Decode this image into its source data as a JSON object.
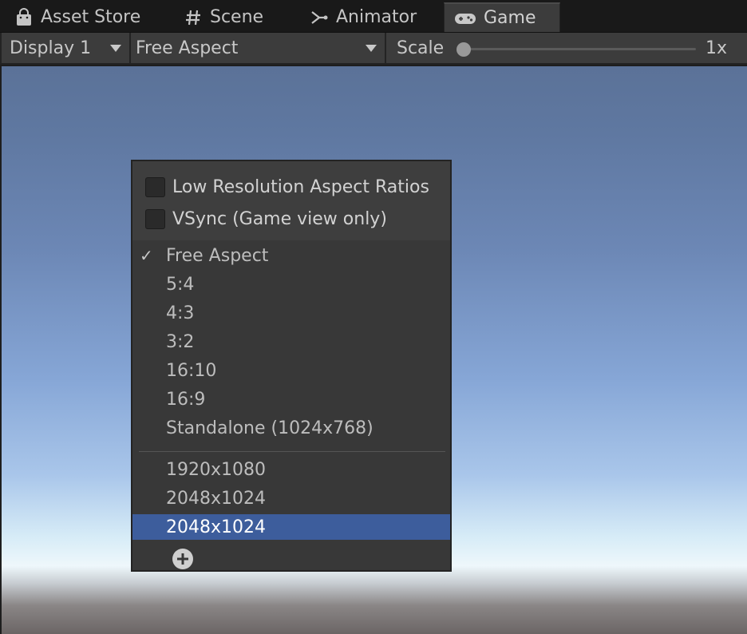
{
  "tabs": [
    {
      "label": "Asset Store",
      "icon": "shopping-bag-icon"
    },
    {
      "label": "Scene",
      "icon": "hash-icon"
    },
    {
      "label": "Animator",
      "icon": "animator-icon"
    },
    {
      "label": "Game",
      "icon": "gamepad-icon",
      "active": true
    }
  ],
  "toolbar": {
    "display": "Display 1",
    "aspect": "Free Aspect",
    "scale_label": "Scale",
    "scale_value": "1x",
    "scale_fraction": 0.0
  },
  "popup": {
    "low_res_label": "Low Resolution Aspect Ratios",
    "low_res_checked": false,
    "vsync_label": "VSync (Game view only)",
    "vsync_checked": false,
    "checkmark": "✓",
    "builtin_items": [
      {
        "label": "Free Aspect",
        "checked": true
      },
      {
        "label": "5:4"
      },
      {
        "label": "4:3"
      },
      {
        "label": "3:2"
      },
      {
        "label": "16:10"
      },
      {
        "label": "16:9"
      },
      {
        "label": "Standalone (1024x768)"
      }
    ],
    "custom_items": [
      {
        "label": "1920x1080"
      },
      {
        "label": "2048x1024"
      },
      {
        "label": "2048x1024",
        "highlighted": true
      }
    ],
    "add_icon": "plus-circle-icon"
  },
  "colors": {
    "highlight": "#3d5d9c",
    "panel": "#383838",
    "toolbar": "#3c3c3c"
  }
}
